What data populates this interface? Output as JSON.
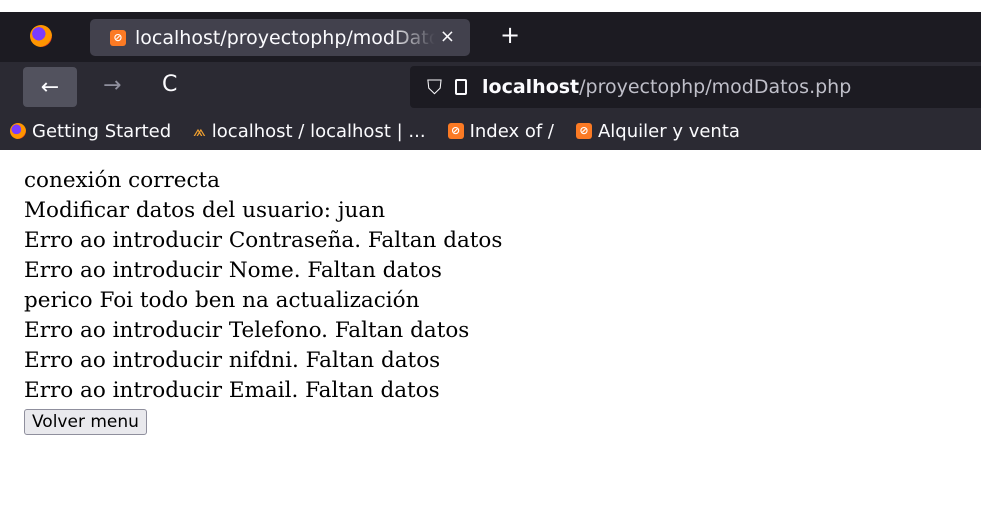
{
  "browser": {
    "tab_title": "localhost/proyectophp/modDatos.php",
    "tab_close": "×",
    "new_tab": "+",
    "back": "←",
    "forward": "→",
    "reload": "C",
    "url_host": "localhost",
    "url_path": "/proyectophp/modDatos.php",
    "bookmarks": [
      {
        "label": "Getting Started",
        "icon": "firefox-icon"
      },
      {
        "label": "localhost / localhost | ...",
        "icon": "phpmyadmin-icon"
      },
      {
        "label": "Index of /",
        "icon": "xampp-icon"
      },
      {
        "label": "Alquiler y venta",
        "icon": "xampp-icon"
      }
    ],
    "xampp_glyph": "⊘"
  },
  "page": {
    "lines": [
      "conexión correcta",
      "Modificar datos del usuario: juan",
      "Erro ao introducir Contraseña. Faltan datos",
      "Erro ao introducir Nome. Faltan datos",
      "perico Foi todo ben na actualización",
      "Erro ao introducir Telefono. Faltan datos",
      "Erro ao introducir nifdni. Faltan datos",
      "Erro ao introducir Email. Faltan datos"
    ],
    "button_label": "Volver menu"
  }
}
